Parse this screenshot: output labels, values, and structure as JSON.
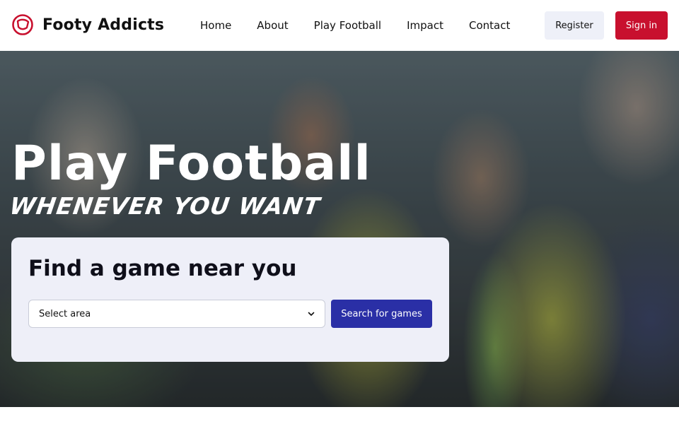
{
  "brand": {
    "name": "Footy Addicts",
    "icon": "football-logo-icon",
    "color": "#c8102e"
  },
  "nav": {
    "items": [
      {
        "label": "Home"
      },
      {
        "label": "About"
      },
      {
        "label": "Play Football"
      },
      {
        "label": "Impact"
      },
      {
        "label": "Contact"
      }
    ]
  },
  "auth": {
    "register_label": "Register",
    "signin_label": "Sign in",
    "signin_color": "#c8102e"
  },
  "hero": {
    "title": "Play Football",
    "subtitle": "WHENEVER YOU WANT"
  },
  "search": {
    "heading": "Find a game near you",
    "select_value": "Select area",
    "button_label": "Search for games",
    "button_color": "#2a2fa6"
  }
}
